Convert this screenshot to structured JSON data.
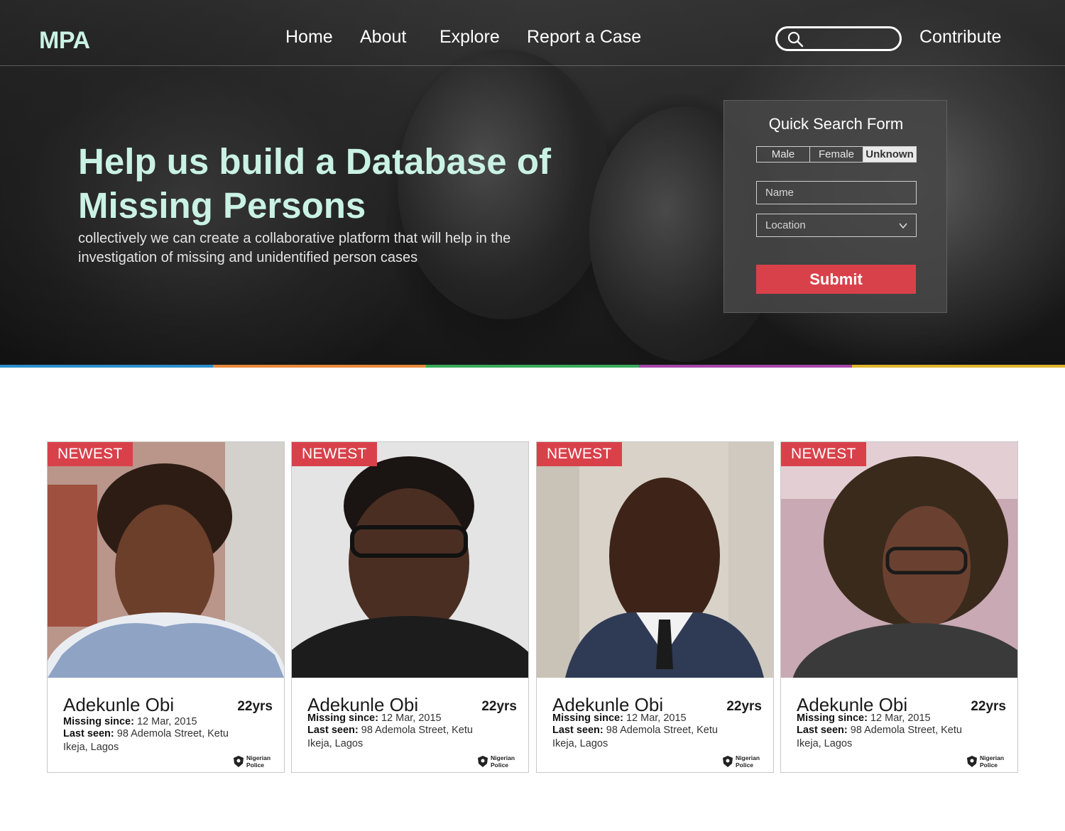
{
  "brand": {
    "logo": "MPA",
    "accent": "#c9f2e4",
    "red": "#d9414a"
  },
  "nav": {
    "links": [
      "Home",
      "About",
      "Explore",
      "Report a Case"
    ],
    "search_placeholder": "",
    "contribute": "Contribute"
  },
  "hero": {
    "headline": "Help us build a Database of Missing Persons",
    "subline": "collectively we can create a collaborative platform that will help in the investigation of missing and unidentified person cases"
  },
  "quick_search": {
    "title": "Quick Search  Form",
    "gender_options": [
      "Male",
      "Female",
      "Unknown"
    ],
    "selected_gender": "Unknown",
    "name_placeholder": "Name",
    "location_placeholder": "Location",
    "submit_label": "Submit"
  },
  "strip_colors": [
    "#2b8ecb",
    "#e8893a",
    "#3aaa5b",
    "#a546a8",
    "#e0b52e"
  ],
  "cards": [
    {
      "badge": "NEWEST",
      "name": "Adekunle Obi",
      "age": "22yrs",
      "missing_label": "Missing since:",
      "missing_date": "12 Mar, 2015",
      "seen_label": "Last seen:",
      "seen_line1": "98 Ademola Street, Ketu",
      "seen_line2": "Ikeja, Lagos",
      "source": "Nigerian Police"
    },
    {
      "badge": "NEWEST",
      "name": "Adekunle Obi",
      "age": "22yrs",
      "missing_label": "Missing since:",
      "missing_date": "12 Mar, 2015",
      "seen_label": "Last seen:",
      "seen_line1": "98 Ademola Street, Ketu",
      "seen_line2": "Ikeja, Lagos",
      "source": "Nigerian Police"
    },
    {
      "badge": "NEWEST",
      "name": "Adekunle Obi",
      "age": "22yrs",
      "missing_label": "Missing since:",
      "missing_date": "12 Mar, 2015",
      "seen_label": "Last seen:",
      "seen_line1": "98 Ademola Street, Ketu",
      "seen_line2": "Ikeja, Lagos",
      "source": "Nigerian Police"
    },
    {
      "badge": "NEWEST",
      "name": "Adekunle Obi",
      "age": "22yrs",
      "missing_label": "Missing since:",
      "missing_date": "12 Mar, 2015",
      "seen_label": "Last seen:",
      "seen_line1": "98 Ademola Street, Ketu",
      "seen_line2": "Ikeja, Lagos",
      "source": "Nigerian Police"
    }
  ]
}
